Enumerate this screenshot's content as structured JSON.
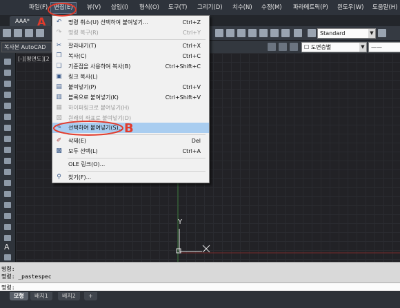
{
  "menubar": {
    "items": [
      "파일(F)",
      "편집(E)",
      "뷰(V)",
      "삽입(I)",
      "형식(O)",
      "도구(T)",
      "그리기(D)",
      "치수(N)",
      "수정(M)",
      "파라메트릭(P)",
      "윈도우(W)",
      "도움말(H)"
    ]
  },
  "document_tab": "AAA*",
  "toolbar": {
    "text_style": "Standard",
    "clipboard_combo": "복사본 AutoCAD",
    "layer_combo": "도면층별"
  },
  "viewport_label": "[-][평면도][2",
  "edit_menu": {
    "items": [
      {
        "label": "명령 취소(U) 선택하여 붙여넣기...",
        "shortcut": "Ctrl+Z",
        "icon": "undo-icon",
        "disabled": false
      },
      {
        "label": "명령 복구(R)",
        "shortcut": "Ctrl+Y",
        "icon": "redo-icon",
        "disabled": true
      },
      {
        "label": "잘라내기(T)",
        "shortcut": "Ctrl+X",
        "icon": "scissors-icon",
        "disabled": false
      },
      {
        "label": "복사(C)",
        "shortcut": "Ctrl+C",
        "icon": "copy-icon",
        "disabled": false
      },
      {
        "label": "기준점을 사용하여 복사(B)",
        "shortcut": "Ctrl+Shift+C",
        "icon": "copy-base-icon",
        "disabled": false
      },
      {
        "label": "링크 복사(L)",
        "shortcut": "",
        "icon": "link-copy-icon",
        "disabled": false
      },
      {
        "label": "붙여넣기(P)",
        "shortcut": "Ctrl+V",
        "icon": "paste-icon",
        "disabled": false
      },
      {
        "label": "블록으로 붙여넣기(K)",
        "shortcut": "Ctrl+Shift+V",
        "icon": "paste-block-icon",
        "disabled": false
      },
      {
        "label": "하이퍼링크로 붙여넣기(H)",
        "shortcut": "",
        "icon": "paste-hyperlink-icon",
        "disabled": true
      },
      {
        "label": "원래의 좌표로 붙여넣기(D)",
        "shortcut": "",
        "icon": "paste-orig-icon",
        "disabled": true
      },
      {
        "label": "선택하여 붙여넣기(S)...",
        "shortcut": "",
        "icon": "paste-special-icon",
        "disabled": false,
        "highlighted": true
      },
      {
        "label": "삭제(E)",
        "shortcut": "Del",
        "icon": "eraser-icon",
        "disabled": false
      },
      {
        "label": "모두 선택(L)",
        "shortcut": "Ctrl+A",
        "icon": "select-all-icon",
        "disabled": false
      },
      {
        "label": "OLE 링크(O)...",
        "shortcut": "",
        "icon": "",
        "disabled": false
      },
      {
        "label": "찾기(F)...",
        "shortcut": "",
        "icon": "find-icon",
        "disabled": false
      }
    ]
  },
  "command": {
    "line1": "명령:",
    "line2": "명령: _pastespec",
    "prompt": "명령:"
  },
  "layout_tabs": [
    "모형",
    "배치1",
    "배치2",
    "+"
  ],
  "annotations": {
    "a": "A",
    "b": "B"
  },
  "ucs": {
    "y_label": "Y"
  },
  "colors": {
    "annotation": "#e23b2c",
    "highlight": "#a9cdf0",
    "background": "#222226"
  }
}
